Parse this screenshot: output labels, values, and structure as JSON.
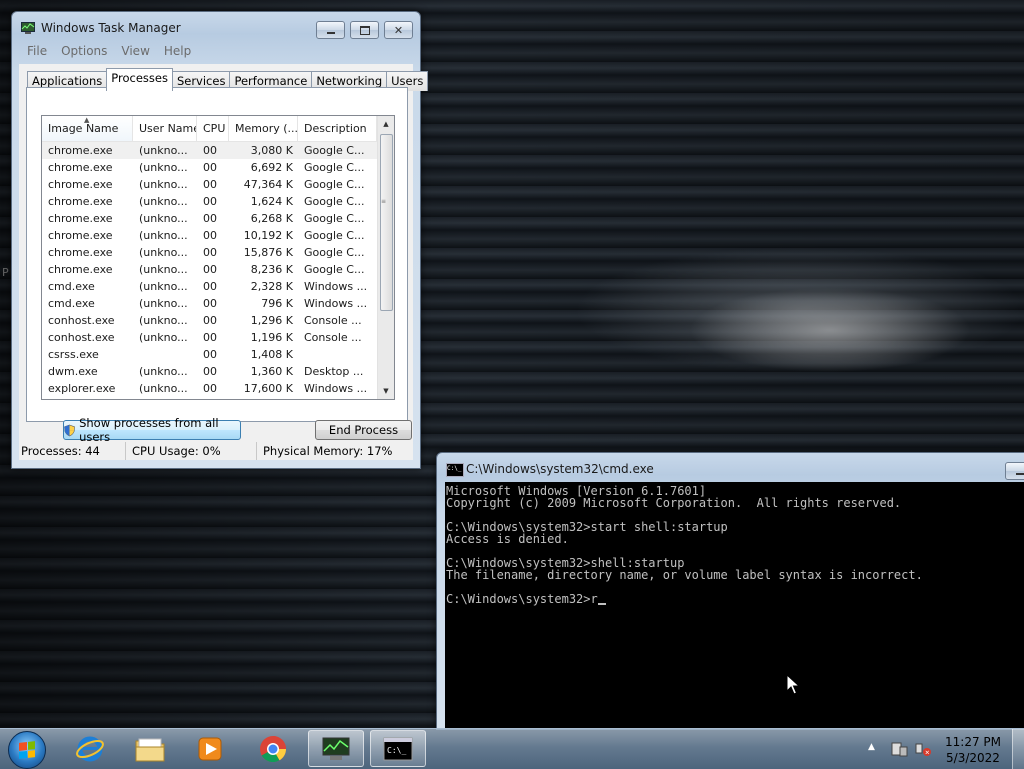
{
  "desktop": {
    "stray_text": "P"
  },
  "task_manager": {
    "title": "Windows Task Manager",
    "menu": [
      "File",
      "Options",
      "View",
      "Help"
    ],
    "tabs": [
      "Applications",
      "Processes",
      "Services",
      "Performance",
      "Networking",
      "Users"
    ],
    "active_tab": "Processes",
    "columns": [
      "Image Name",
      "User Name",
      "CPU",
      "Memory (...",
      "Description"
    ],
    "rows": [
      {
        "name": "chrome.exe",
        "user": "(unkno...",
        "cpu": "00",
        "mem": "3,080 K",
        "desc": "Google C..."
      },
      {
        "name": "chrome.exe",
        "user": "(unkno...",
        "cpu": "00",
        "mem": "6,692 K",
        "desc": "Google C..."
      },
      {
        "name": "chrome.exe",
        "user": "(unkno...",
        "cpu": "00",
        "mem": "47,364 K",
        "desc": "Google C..."
      },
      {
        "name": "chrome.exe",
        "user": "(unkno...",
        "cpu": "00",
        "mem": "1,624 K",
        "desc": "Google C..."
      },
      {
        "name": "chrome.exe",
        "user": "(unkno...",
        "cpu": "00",
        "mem": "6,268 K",
        "desc": "Google C..."
      },
      {
        "name": "chrome.exe",
        "user": "(unkno...",
        "cpu": "00",
        "mem": "10,192 K",
        "desc": "Google C..."
      },
      {
        "name": "chrome.exe",
        "user": "(unkno...",
        "cpu": "00",
        "mem": "15,876 K",
        "desc": "Google C..."
      },
      {
        "name": "chrome.exe",
        "user": "(unkno...",
        "cpu": "00",
        "mem": "8,236 K",
        "desc": "Google C..."
      },
      {
        "name": "cmd.exe",
        "user": "(unkno...",
        "cpu": "00",
        "mem": "2,328 K",
        "desc": "Windows ..."
      },
      {
        "name": "cmd.exe",
        "user": "(unkno...",
        "cpu": "00",
        "mem": "796 K",
        "desc": "Windows ..."
      },
      {
        "name": "conhost.exe",
        "user": "(unkno...",
        "cpu": "00",
        "mem": "1,296 K",
        "desc": "Console ..."
      },
      {
        "name": "conhost.exe",
        "user": "(unkno...",
        "cpu": "00",
        "mem": "1,196 K",
        "desc": "Console ..."
      },
      {
        "name": "csrss.exe",
        "user": "",
        "cpu": "00",
        "mem": "1,408 K",
        "desc": ""
      },
      {
        "name": "dwm.exe",
        "user": "(unkno...",
        "cpu": "00",
        "mem": "1,360 K",
        "desc": "Desktop ..."
      },
      {
        "name": "explorer.exe",
        "user": "(unkno...",
        "cpu": "00",
        "mem": "17,600 K",
        "desc": "Windows ..."
      }
    ],
    "show_all_label": "Show processes from all users",
    "end_process_label": "End Process",
    "status": {
      "processes": "Processes: 44",
      "cpu": "CPU Usage: 0%",
      "memory": "Physical Memory: 17%"
    }
  },
  "cmd": {
    "title": "C:\\Windows\\system32\\cmd.exe",
    "icon_text": "C:\\_",
    "lines": [
      "Microsoft Windows [Version 6.1.7601]",
      "Copyright (c) 2009 Microsoft Corporation.  All rights reserved.",
      "",
      "C:\\Windows\\system32>start shell:startup",
      "Access is denied.",
      "",
      "C:\\Windows\\system32>shell:startup",
      "The filename, directory name, or volume label syntax is incorrect.",
      ""
    ],
    "prompt": "C:\\Windows\\system32>r"
  },
  "taskbar": {
    "apps": [
      "internet-explorer",
      "windows-explorer",
      "media-player",
      "chrome",
      "task-manager",
      "cmd"
    ],
    "clock_time": "11:27 PM",
    "clock_date": "5/3/2022"
  }
}
